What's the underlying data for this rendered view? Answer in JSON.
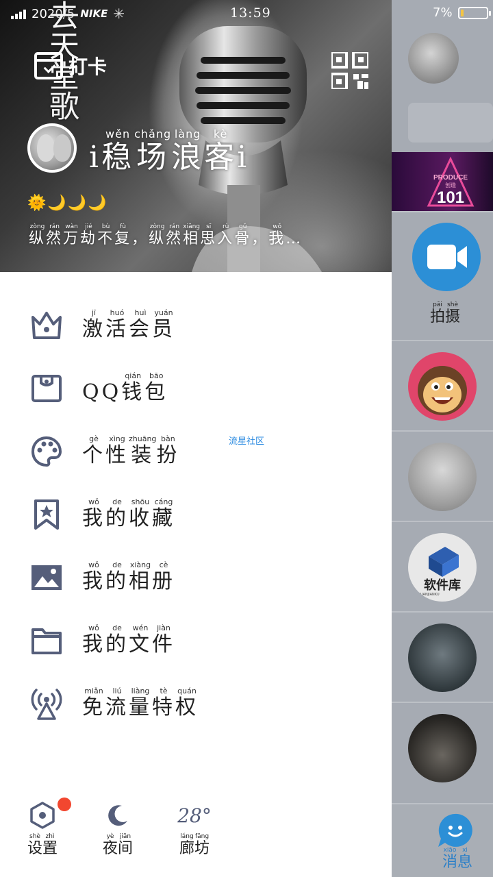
{
  "status_bar": {
    "date": "2020/5",
    "brand": "NIKE",
    "time": "13:59",
    "battery": "7%"
  },
  "header": {
    "vertical_text": "去天堂歌",
    "checkin_label": "打卡",
    "nickname": [
      {
        "ch": "i",
        "py": ""
      },
      {
        "ch": "稳",
        "py": "wěn"
      },
      {
        "ch": "场",
        "py": "chǎng"
      },
      {
        "ch": "浪",
        "py": "làng"
      },
      {
        "ch": "客",
        "py": "kè"
      },
      {
        "ch": "i",
        "py": ""
      }
    ],
    "weather_icons": "🌞🌙🌙🌙",
    "signature": [
      {
        "ch": "纵",
        "py": "zòng"
      },
      {
        "ch": "然",
        "py": "rán"
      },
      {
        "ch": "万",
        "py": "wàn"
      },
      {
        "ch": "劫",
        "py": "jié"
      },
      {
        "ch": "不",
        "py": "bù"
      },
      {
        "ch": "复",
        "py": "fù"
      },
      {
        "ch": "，",
        "py": ""
      },
      {
        "ch": "纵",
        "py": "zòng"
      },
      {
        "ch": "然",
        "py": "rán"
      },
      {
        "ch": "相",
        "py": "xiāng"
      },
      {
        "ch": "思",
        "py": "sī"
      },
      {
        "ch": "入",
        "py": "rù"
      },
      {
        "ch": "骨",
        "py": "gǔ"
      },
      {
        "ch": "，",
        "py": ""
      },
      {
        "ch": "我",
        "py": "wǒ"
      },
      {
        "ch": "…",
        "py": ""
      }
    ]
  },
  "menu": [
    {
      "name": "vip",
      "chars": [
        {
          "ch": "激",
          "py": "jī"
        },
        {
          "ch": "活",
          "py": "huó"
        },
        {
          "ch": "会",
          "py": "huì"
        },
        {
          "ch": "员",
          "py": "yuán"
        }
      ]
    },
    {
      "name": "wallet",
      "chars": [
        {
          "ch": "QQ",
          "py": ""
        },
        {
          "ch": "钱",
          "py": "qián"
        },
        {
          "ch": "包",
          "py": "bāo"
        }
      ]
    },
    {
      "name": "theme",
      "chars": [
        {
          "ch": "个",
          "py": "gè"
        },
        {
          "ch": "性",
          "py": "xìng"
        },
        {
          "ch": "装",
          "py": "zhuāng"
        },
        {
          "ch": "扮",
          "py": "bàn"
        }
      ],
      "badge": "流星社区"
    },
    {
      "name": "favorites",
      "chars": [
        {
          "ch": "我",
          "py": "wǒ"
        },
        {
          "ch": "的",
          "py": "de"
        },
        {
          "ch": "收",
          "py": "shōu"
        },
        {
          "ch": "藏",
          "py": "cáng"
        }
      ]
    },
    {
      "name": "album",
      "chars": [
        {
          "ch": "我",
          "py": "wǒ"
        },
        {
          "ch": "的",
          "py": "de"
        },
        {
          "ch": "相",
          "py": "xiàng"
        },
        {
          "ch": "册",
          "py": "cè"
        }
      ]
    },
    {
      "name": "files",
      "chars": [
        {
          "ch": "我",
          "py": "wǒ"
        },
        {
          "ch": "的",
          "py": "de"
        },
        {
          "ch": "文",
          "py": "wén"
        },
        {
          "ch": "件",
          "py": "jiàn"
        }
      ]
    },
    {
      "name": "free-data",
      "chars": [
        {
          "ch": "免",
          "py": "miǎn"
        },
        {
          "ch": "流",
          "py": "liú"
        },
        {
          "ch": "量",
          "py": "liàng"
        },
        {
          "ch": "特",
          "py": "tè"
        },
        {
          "ch": "权",
          "py": "quán"
        }
      ]
    }
  ],
  "bottom": {
    "settings": [
      {
        "ch": "设",
        "py": "shè"
      },
      {
        "ch": "置",
        "py": "zhì"
      }
    ],
    "night": [
      {
        "ch": "夜",
        "py": "yè"
      },
      {
        "ch": "间",
        "py": "jiān"
      }
    ],
    "temperature": "28°",
    "location": [
      {
        "ch": "廊",
        "py": "láng"
      },
      {
        "ch": "坊",
        "py": "fāng"
      }
    ]
  },
  "right_panel": {
    "produce_small": "PRODUCE",
    "produce_cn": "创造",
    "produce_num": "101",
    "camera_label": [
      {
        "ch": "拍",
        "py": "pāi"
      },
      {
        "ch": "摄",
        "py": "shè"
      }
    ],
    "software_cn": "软件库",
    "software_en": "RUANJIANKU",
    "messages_label": [
      {
        "ch": "消",
        "py": "xiāo"
      },
      {
        "ch": "息",
        "py": "xi"
      }
    ]
  },
  "colors": {
    "icon_gray": "#555e7a",
    "accent_blue": "#2c8fd6",
    "badge_blue": "#2a8ae0",
    "red_dot": "#f2472f"
  }
}
